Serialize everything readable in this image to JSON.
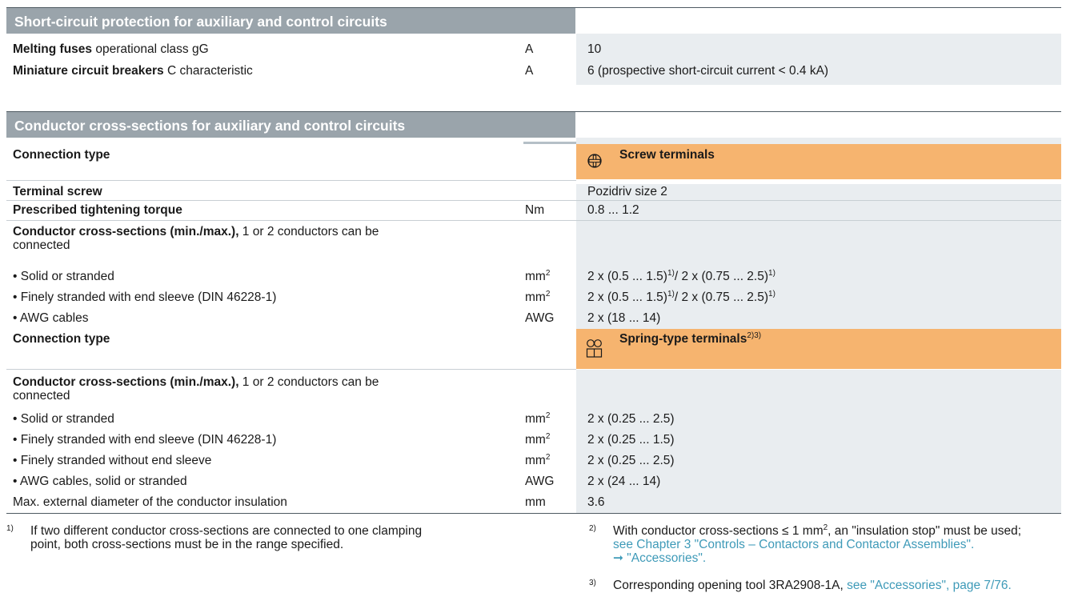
{
  "sec1": {
    "title": "Short-circuit protection for auxiliary and control circuits",
    "rows": [
      {
        "bold": "Melting fuses",
        "rest": " operational class gG",
        "unit": "A",
        "val": "10"
      },
      {
        "bold": "Miniature circuit breakers",
        "rest": " C characteristic",
        "unit": "A",
        "val": "6 (prospective short-circuit current < 0.4 kA)"
      }
    ]
  },
  "sec2": {
    "title": "Conductor cross-sections for auxiliary and control circuits",
    "conn1": "Connection type",
    "screw": "Screw terminals",
    "terminal_screw": "Terminal screw",
    "terminal_screw_val": "Pozidriv size 2",
    "torque": "Prescribed tightening torque",
    "torque_unit": "Nm",
    "torque_val": "0.8 ... 1.2",
    "cs_bold": "Conductor cross-sections (min./max.),",
    "cs_rest": " 1 or 2 conductors can be",
    "cs_rest2": "connected",
    "screw_rows": [
      {
        "label": "• Solid or stranded",
        "unit": "mm",
        "val": "2 x (0.5 ... 1.5)",
        "val2": "/ 2 x (0.75 ... 2.5)"
      },
      {
        "label": "• Finely stranded with end sleeve (DIN 46228-1)",
        "unit": "mm",
        "val": "2 x (0.5 ... 1.5)",
        "val2": "/ 2 x (0.75 ... 2.5)"
      },
      {
        "label": "• AWG cables",
        "unit": "AWG",
        "val": "2 x (18 ... 14)"
      }
    ],
    "conn2": "Connection type",
    "spring": "Spring-type terminals",
    "spring_sup": "2)3)",
    "spring_rows": [
      {
        "label": "• Solid or stranded",
        "unit": "mm",
        "val": "2 x (0.25 ... 2.5)"
      },
      {
        "label": "• Finely stranded with end sleeve (DIN 46228-1)",
        "unit": "mm",
        "val": "2 x (0.25 ... 1.5)"
      },
      {
        "label": "• Finely stranded without end sleeve",
        "unit": "mm",
        "val": "2 x (0.25 ... 2.5)"
      },
      {
        "label": "• AWG cables, solid or stranded",
        "unit": "AWG",
        "val": "2 x (24 ... 14)"
      },
      {
        "label": "Max. external diameter of the conductor insulation",
        "unit": "mm",
        "val": "3.6"
      }
    ]
  },
  "footnotes": {
    "f1_num": "1)",
    "f1_l1": "If two different conductor cross-sections are connected to one clamping",
    "f1_l2": "point, both cross-sections must be in the range specified.",
    "f2_num": "2)",
    "f2_l1a": "With conductor cross-sections ≤ 1 mm",
    "f2_l1b": ", an \"insulation stop\" must be used;",
    "f2_l2": "see Chapter 3 \"Controls – Contactors and Contactor Assemblies\".",
    "f2_l3": "➞ \"Accessories\".",
    "f3_num": "3)",
    "f3_text": "Corresponding opening tool 3RA2908-1A, ",
    "f3_link": "see \"Accessories\", page 7/76."
  },
  "sup1": "1)",
  "sup2": "2"
}
